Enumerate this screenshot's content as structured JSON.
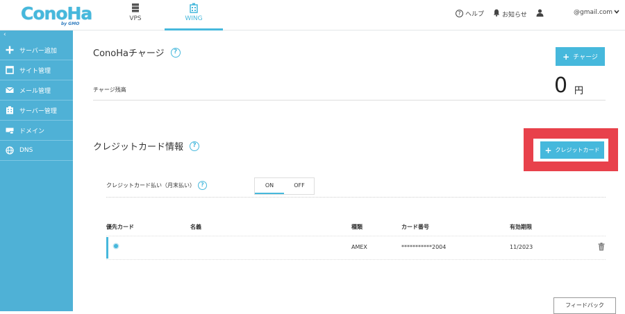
{
  "header": {
    "logo": "ConoHa",
    "logo_sub": "by GMO",
    "nav": [
      {
        "label": "VPS",
        "icon": "server-icon"
      },
      {
        "label": "WING",
        "icon": "building-icon",
        "active": true
      }
    ],
    "help": "ヘルプ",
    "notice": "お知らせ",
    "account": "@gmail.com"
  },
  "sidebar": {
    "collapse": "‹",
    "items": [
      {
        "label": "サーバー追加",
        "icon": "plus-icon"
      },
      {
        "label": "サイト管理",
        "icon": "window-icon"
      },
      {
        "label": "メール管理",
        "icon": "mail-icon"
      },
      {
        "label": "サーバー管理",
        "icon": "server-manage-icon"
      },
      {
        "label": "ドメイン",
        "icon": "domain-icon"
      },
      {
        "label": "DNS",
        "icon": "globe-icon"
      }
    ]
  },
  "charge": {
    "title": "ConoHaチャージ",
    "button": "チャージ",
    "balance_label": "チャージ残高",
    "balance_value": "0",
    "balance_unit": "円"
  },
  "credit": {
    "title": "クレジットカード情報",
    "button": "クレジットカード",
    "pay_label": "クレジットカード払い（月末払い）",
    "toggle": {
      "on": "ON",
      "off": "OFF",
      "selected": "ON"
    },
    "columns": [
      "優先カード",
      "名義",
      "種類",
      "カード番号",
      "有効期限"
    ],
    "rows": [
      {
        "name": "",
        "type": "AMEX",
        "number": "***********2004",
        "expiry": "11/2023"
      }
    ]
  },
  "feedback": "フィードバック",
  "colors": {
    "accent": "#46b8dc",
    "sidebar": "#4fb1d6",
    "highlight": "#e8414b"
  }
}
